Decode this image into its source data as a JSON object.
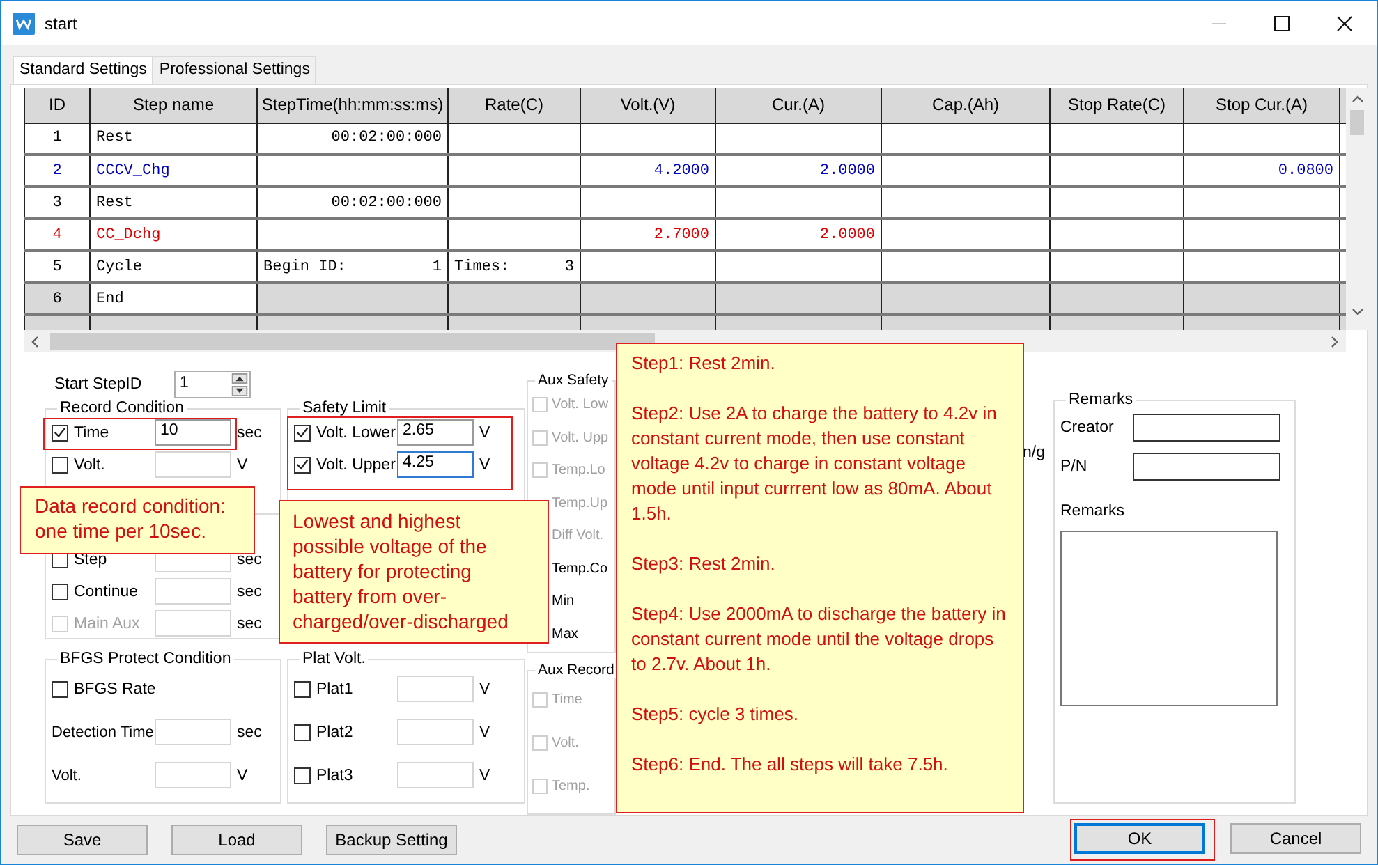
{
  "window": {
    "title": "start"
  },
  "tabs": [
    {
      "label": "Standard Settings",
      "selected": true
    },
    {
      "label": "Professional Settings",
      "selected": false
    }
  ],
  "table": {
    "columns": [
      "ID",
      "Step name",
      "StepTime(hh:mm:ss:ms)",
      "Rate(C)",
      "Volt.(V)",
      "Cur.(A)",
      "Cap.(Ah)",
      "Stop Rate(C)",
      "Stop Cur.(A)"
    ],
    "rows": [
      {
        "kind": "step",
        "color": "#000000",
        "id": "1",
        "name": "Rest",
        "cells": [
          "00:02:00:000",
          "",
          "",
          "",
          "",
          "",
          ""
        ]
      },
      {
        "kind": "step",
        "color": "#0000c0",
        "id": "2",
        "name": "CCCV_Chg",
        "cells": [
          "",
          "",
          "4.2000",
          "2.0000",
          "",
          "",
          "0.0800"
        ]
      },
      {
        "kind": "step",
        "color": "#000000",
        "id": "3",
        "name": "Rest",
        "cells": [
          "00:02:00:000",
          "",
          "",
          "",
          "",
          "",
          ""
        ]
      },
      {
        "kind": "step",
        "color": "#e00000",
        "id": "4",
        "name": "CC_Dchg",
        "cells": [
          "",
          "",
          "2.7000",
          "2.0000",
          "",
          "",
          ""
        ]
      },
      {
        "kind": "cycle",
        "color": "#000000",
        "id": "5",
        "name": "Cycle",
        "begin_label": "Begin ID:",
        "begin_id": "1",
        "times_label": "Times:",
        "times": "3"
      },
      {
        "kind": "end",
        "color": "#000000",
        "id": "6",
        "name": "End"
      }
    ]
  },
  "start_step": {
    "label": "Start StepID",
    "value": "1"
  },
  "record_condition": {
    "title": "Record Condition",
    "items": [
      {
        "label": "Time",
        "checked": true,
        "disabled": false,
        "value": "10",
        "unit": "sec",
        "highlighted": true
      },
      {
        "label": "Volt.",
        "checked": false,
        "disabled": false,
        "value": "",
        "unit": "V"
      }
    ]
  },
  "record_condition_more": {
    "items": [
      {
        "label": "Step",
        "checked": false,
        "disabled": false,
        "value": "",
        "unit": "sec"
      },
      {
        "label": "Continue",
        "checked": false,
        "disabled": false,
        "value": "",
        "unit": "sec"
      },
      {
        "label": "Main Aux",
        "checked": false,
        "disabled": true,
        "value": "",
        "unit": "sec"
      }
    ]
  },
  "safety_limit": {
    "title": "Safety Limit",
    "highlighted": true,
    "items": [
      {
        "label": "Volt. Lower",
        "checked": true,
        "disabled": false,
        "value": "2.65",
        "unit": "V",
        "focused": false
      },
      {
        "label": "Volt. Upper",
        "checked": true,
        "disabled": false,
        "value": "4.25",
        "unit": "V",
        "focused": true
      }
    ]
  },
  "aux_safety": {
    "title": "Aux Safety",
    "items": [
      {
        "kind": "checkbox",
        "label": "Volt. Low",
        "checked": false,
        "disabled": true
      },
      {
        "kind": "checkbox",
        "label": "Volt. Upp",
        "checked": false,
        "disabled": true
      },
      {
        "kind": "checkbox",
        "label": "Temp.Lo",
        "checked": false,
        "disabled": true
      },
      {
        "kind": "label",
        "label": "Temp.Up",
        "disabled": true
      },
      {
        "kind": "label",
        "label": "Diff Volt.",
        "disabled": true
      },
      {
        "kind": "label",
        "label": "Temp.Co",
        "disabled": false
      },
      {
        "kind": "text",
        "label": "Min"
      },
      {
        "kind": "text",
        "label": "Max"
      }
    ]
  },
  "aux_fragment": {
    "text": "n/g"
  },
  "bfgs": {
    "title": "BFGS Protect Condition",
    "items": [
      {
        "kind": "checkbox",
        "label": "BFGS Rate",
        "checked": false
      },
      {
        "kind": "field",
        "label": "Detection Time",
        "value": "",
        "unit": "sec"
      },
      {
        "kind": "field",
        "label": "Volt.",
        "value": "",
        "unit": "V"
      }
    ]
  },
  "plat_volt": {
    "title": "Plat Volt.",
    "items": [
      {
        "label": "Plat1",
        "checked": false,
        "disabled": false,
        "value": "",
        "unit": "V"
      },
      {
        "label": "Plat2",
        "checked": false,
        "disabled": false,
        "value": "",
        "unit": "V"
      },
      {
        "label": "Plat3",
        "checked": false,
        "disabled": false,
        "value": "",
        "unit": "V"
      }
    ]
  },
  "aux_record": {
    "title": "Aux Record",
    "items": [
      {
        "kind": "checkbox",
        "label": "Time",
        "checked": false,
        "disabled": true
      },
      {
        "kind": "checkbox",
        "label": "Volt.",
        "checked": false,
        "disabled": true
      },
      {
        "kind": "checkbox",
        "label": "Temp.",
        "checked": false,
        "disabled": true
      }
    ]
  },
  "remarks": {
    "title": "Remarks",
    "fields": [
      {
        "label": "Creator"
      },
      {
        "label": "P/N"
      }
    ],
    "notes_label": "Remarks"
  },
  "buttons_left": [
    {
      "label": "Save"
    },
    {
      "label": "Load"
    },
    {
      "label": "Backup Setting"
    }
  ],
  "buttons_right": [
    {
      "label": "OK",
      "focused": true,
      "highlighted": true
    },
    {
      "label": "Cancel",
      "focused": false,
      "highlighted": false
    }
  ],
  "callouts": [
    {
      "paragraphs": [
        "Data record condition: one time per 10sec."
      ]
    },
    {
      "paragraphs": [
        "Lowest and highest possible voltage of the battery for protecting battery from over-charged/over-discharged"
      ]
    },
    {
      "paragraphs": [
        "Step1: Rest 2min.",
        "Step2: Use 2A to charge the battery to 4.2v in constant current mode, then use constant voltage 4.2v to charge in constant voltage mode until input currrent low as 80mA. About 1.5h.",
        "Step3: Rest 2min.",
        "Step4: Use 2000mA to discharge the battery in constant current mode until the voltage drops to 2.7v. About 1h.",
        "Step5: cycle 3 times.",
        "Step6: End. The all steps will take 7.5h."
      ]
    }
  ]
}
